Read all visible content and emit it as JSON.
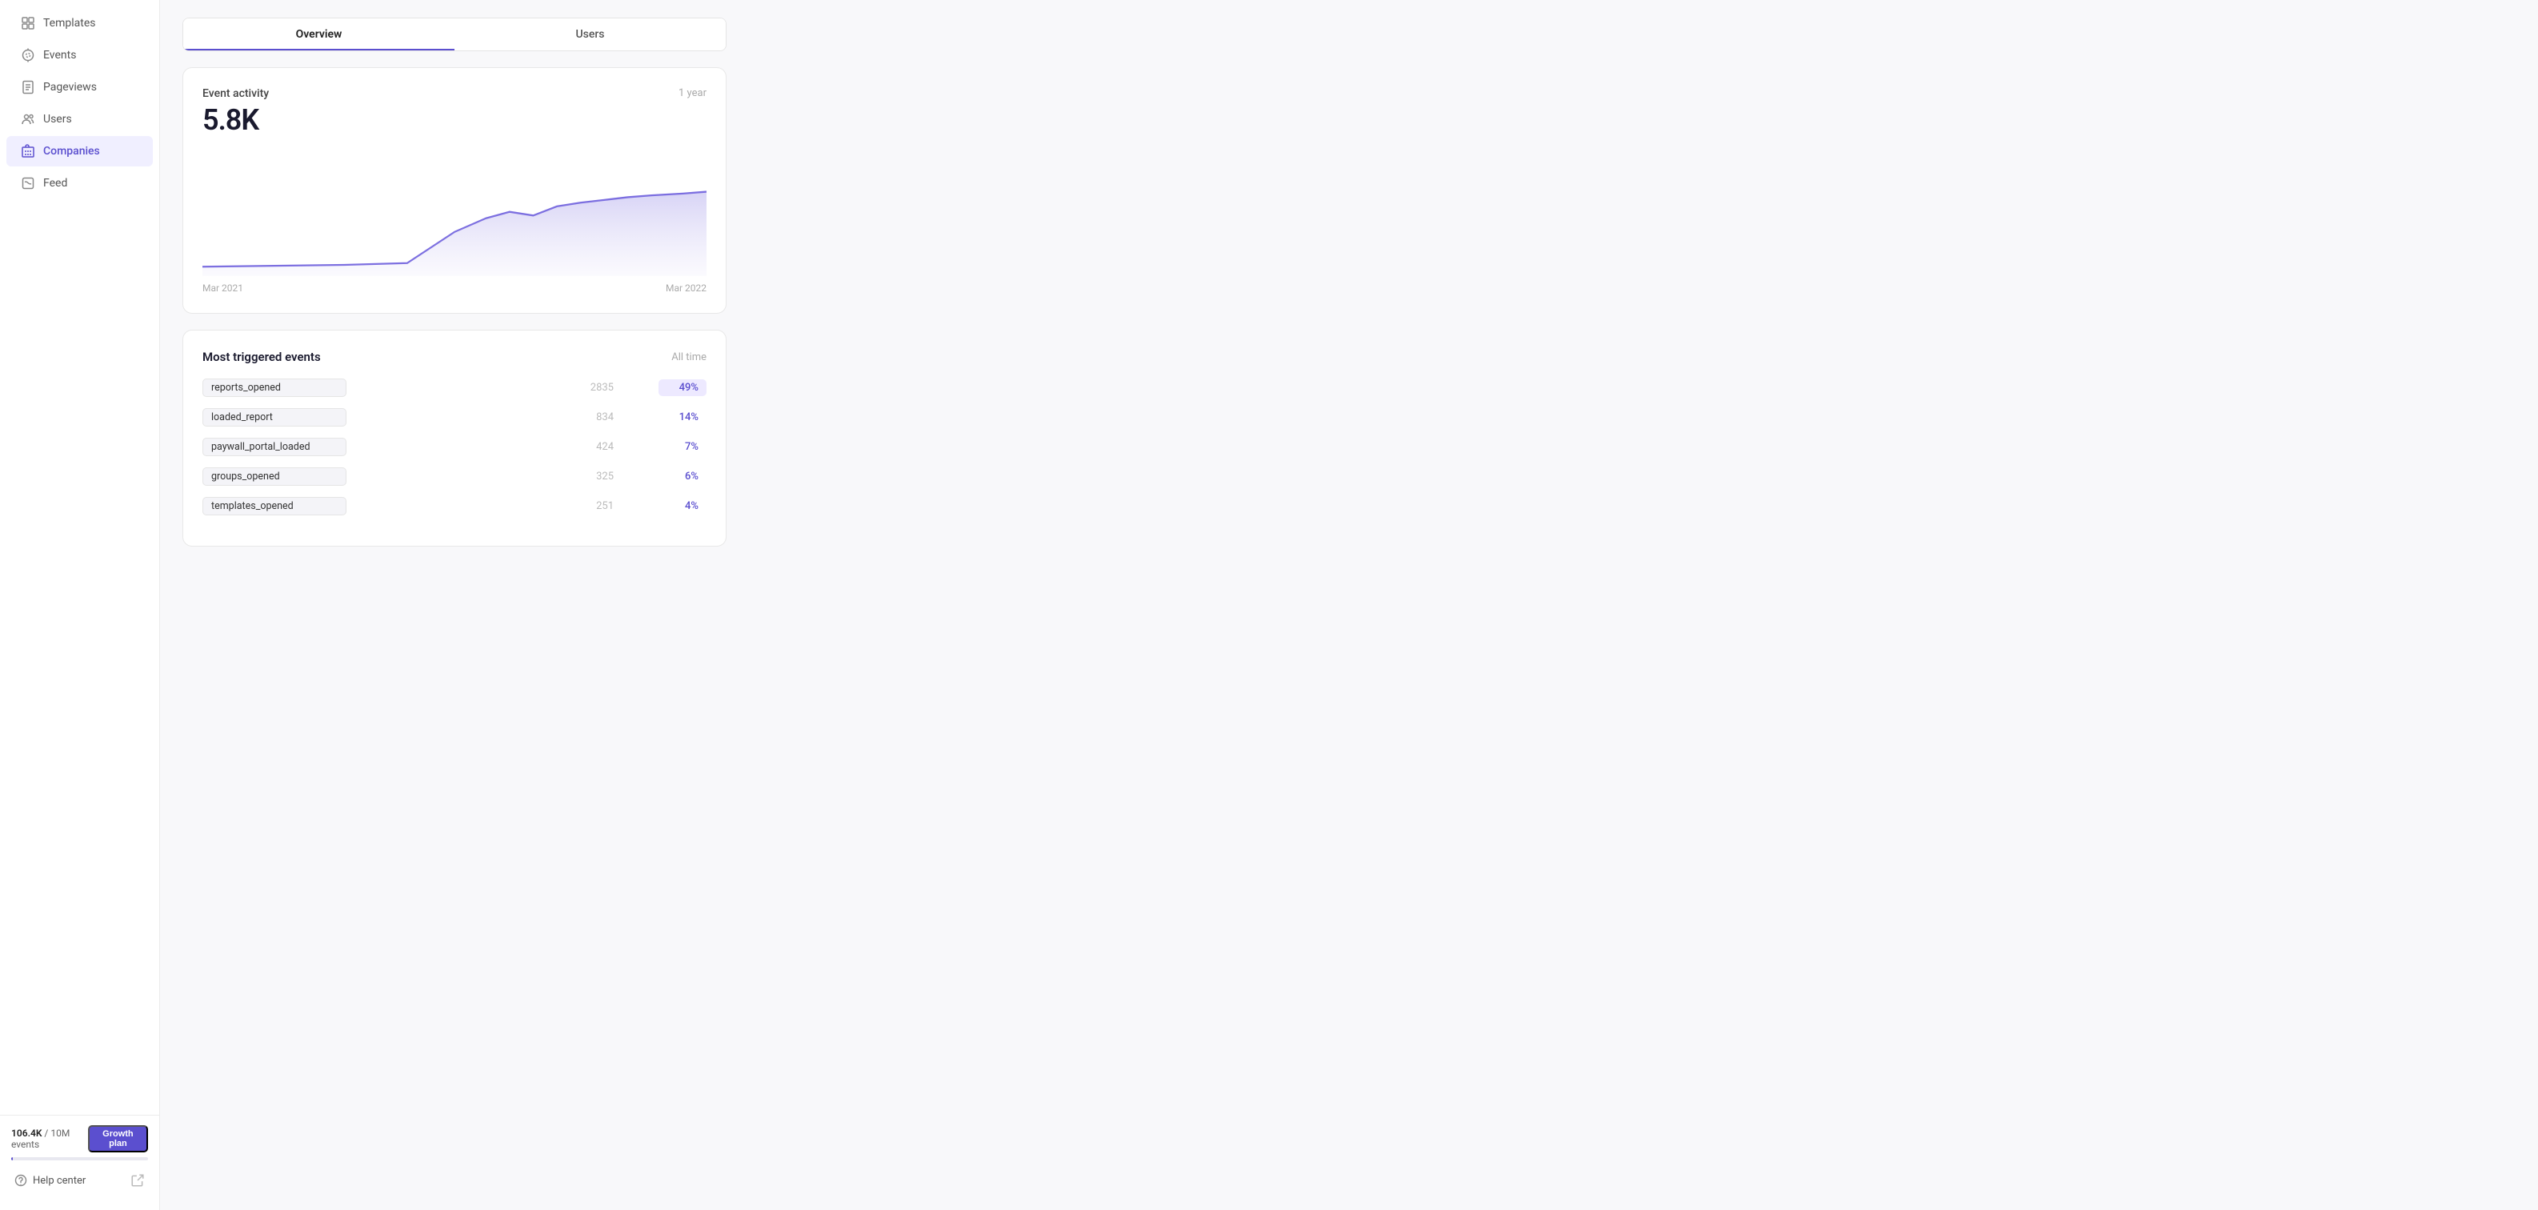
{
  "sidebar": {
    "items": [
      {
        "id": "templates",
        "label": "Templates",
        "icon": "grid"
      },
      {
        "id": "events",
        "label": "Events",
        "icon": "star"
      },
      {
        "id": "pageviews",
        "label": "Pageviews",
        "icon": "file"
      },
      {
        "id": "users",
        "label": "Users",
        "icon": "users"
      },
      {
        "id": "companies",
        "label": "Companies",
        "icon": "building",
        "active": true
      },
      {
        "id": "feed",
        "label": "Feed",
        "icon": "feed"
      }
    ]
  },
  "footer": {
    "usage_text": "106.4K",
    "usage_limit": "10M",
    "usage_unit": "events",
    "plan_label": "Growth plan",
    "help_label": "Help center"
  },
  "main": {
    "tabs": [
      {
        "id": "overview",
        "label": "Overview",
        "active": true
      },
      {
        "id": "users",
        "label": "Users",
        "active": false
      }
    ],
    "event_activity": {
      "title": "Event activity",
      "period": "1 year",
      "value": "5.8K",
      "x_start": "Mar 2021",
      "x_end": "Mar 2022"
    },
    "most_triggered": {
      "title": "Most triggered events",
      "period": "All time",
      "events": [
        {
          "name": "reports_opened",
          "count": "2835",
          "percent": "49%",
          "highlight": true
        },
        {
          "name": "loaded_report",
          "count": "834",
          "percent": "14%",
          "highlight": false
        },
        {
          "name": "paywall_portal_loaded",
          "count": "424",
          "percent": "7%",
          "highlight": false
        },
        {
          "name": "groups_opened",
          "count": "325",
          "percent": "6%",
          "highlight": false
        },
        {
          "name": "templates_opened",
          "count": "251",
          "percent": "4%",
          "highlight": false
        }
      ]
    }
  }
}
